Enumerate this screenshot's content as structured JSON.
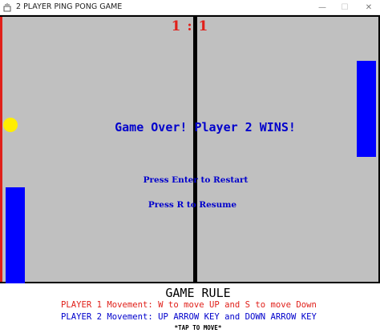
{
  "window": {
    "title": "2 PLAYER PING PONG GAME",
    "minimize_glyph": "—",
    "maximize_glyph": "☐",
    "close_glyph": "✕",
    "icon": "java-app-icon"
  },
  "game": {
    "score_text": "1 : 1",
    "score": {
      "player1": 1,
      "player2": 1
    },
    "game_over_text": "Game Over! Player 2 WINS!",
    "restart_text": "Press Enter to Restart",
    "resume_text": "Press R to Resume",
    "colors": {
      "court": "#c0c0c0",
      "paddle": "#0000ff",
      "ball": "#ffee00",
      "left_wall": "#e0201a",
      "score": "#e0201a",
      "message": "#0000cc"
    }
  },
  "rules": {
    "title": "GAME RULE",
    "player1": "PLAYER 1 Movement: W to move UP and S to move Down",
    "player2": "PLAYER 2 Movement: UP ARROW KEY and DOWN ARROW KEY",
    "tap_hint": "*TAP TO MOVE*",
    "colors": {
      "player1": "#e0201a",
      "player2": "#0000cc"
    }
  }
}
